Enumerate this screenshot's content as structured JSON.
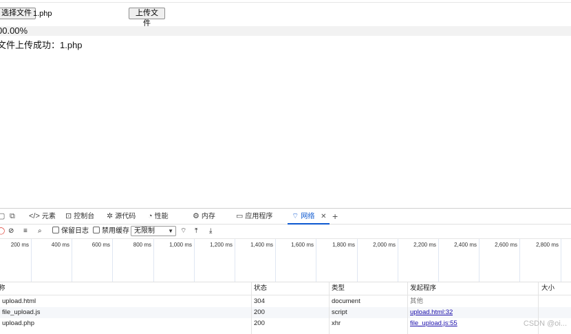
{
  "page": {
    "choose_file_label": "选择文件",
    "file_name": "1.php",
    "upload_label": "上传文件",
    "progress": "00.00%",
    "success_message": "文件上传成功：1.php"
  },
  "devtools": {
    "tabs": [
      {
        "label": "元素",
        "icon": "code-icon"
      },
      {
        "label": "控制台",
        "icon": "console-icon"
      },
      {
        "label": "源代码",
        "icon": "bug-icon"
      },
      {
        "label": "性能",
        "icon": "performance-icon"
      },
      {
        "label": "内存",
        "icon": "gear-icon"
      },
      {
        "label": "应用程序",
        "icon": "app-icon"
      },
      {
        "label": "网络",
        "icon": "wifi-icon",
        "active": true
      }
    ],
    "toolbar": {
      "preserve_log": "保留日志",
      "disable_cache": "禁用缓存",
      "throttle": "无限制"
    },
    "timeline_ticks": [
      "200 ms",
      "400 ms",
      "600 ms",
      "800 ms",
      "1,000 ms",
      "1,200 ms",
      "1,400 ms",
      "1,600 ms",
      "1,800 ms",
      "2,000 ms",
      "2,200 ms",
      "2,400 ms",
      "2,600 ms",
      "2,800 ms"
    ],
    "table": {
      "headers": {
        "name": "称",
        "status": "状态",
        "type": "类型",
        "initiator": "发起程序",
        "size": "大小"
      },
      "rows": [
        {
          "name": "upload.html",
          "status": "304",
          "type": "document",
          "initiator": "其他"
        },
        {
          "name": "file_upload.js",
          "status": "200",
          "type": "script",
          "initiator": "upload.html:32"
        },
        {
          "name": "upload.php",
          "status": "200",
          "type": "xhr",
          "initiator": "file_upload.js:55"
        }
      ]
    }
  },
  "watermark": "CSDN @oi..."
}
